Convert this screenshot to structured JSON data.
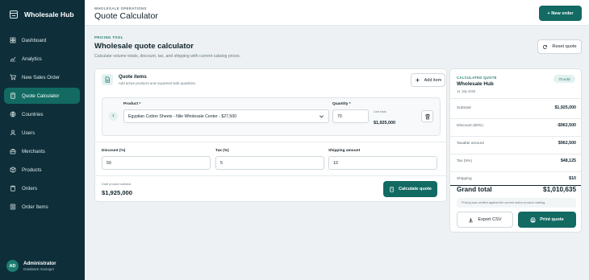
{
  "sidebar": {
    "brand": "Wholesale Hub",
    "items": [
      {
        "label": "Dashboard",
        "icon": "grid-icon"
      },
      {
        "label": "Analytics",
        "icon": "chart-icon"
      },
      {
        "label": "New Sales Order",
        "icon": "cart-icon"
      },
      {
        "label": "Quote Calculator",
        "icon": "calculator-icon",
        "active": true
      },
      {
        "label": "Countries",
        "icon": "globe-icon"
      },
      {
        "label": "Users",
        "icon": "user-icon"
      },
      {
        "label": "Merchants",
        "icon": "briefcase-icon"
      },
      {
        "label": "Products",
        "icon": "box-icon"
      },
      {
        "label": "Orders",
        "icon": "clipboard-icon"
      },
      {
        "label": "Order Items",
        "icon": "list-icon"
      }
    ],
    "user": {
      "initials": "AD",
      "name": "Administrator",
      "role": "Database manager"
    }
  },
  "header": {
    "eyebrow": "WHOLESALE OPERATIONS",
    "title": "Quote Calculator",
    "new_order": "+ New order"
  },
  "tool": {
    "eyebrow": "PRICING TOOL",
    "title": "Wholesale quote calculator",
    "subtitle": "Calculate volume totals, discount, tax, and shipping with current catalog prices.",
    "reset": "Reset quote"
  },
  "items": {
    "title": "Quote items",
    "subtitle": "Add active products and requested bulk quantities.",
    "add_item": "Add item",
    "line": {
      "number": "1",
      "product_label": "Product *",
      "product_value": "Egyptian Cotton Sheets - Nile Wholesale Center - $27,500",
      "quantity_label": "Quantity *",
      "quantity_value": "70",
      "line_total_label": "Line total",
      "line_total_value": "$1,925,000"
    },
    "discount_label": "Discount (%)",
    "discount_value": "50",
    "tax_label": "Tax (%)",
    "tax_value": "5",
    "shipping_label": "Shipping amount",
    "shipping_value": "10",
    "draft_label": "Draft product subtotal",
    "draft_value": "$1,925,000",
    "calculate": "Calculate quote"
  },
  "summary": {
    "eyebrow": "CALCULATED QUOTE",
    "title": "Wholesale Hub",
    "date": "14 July 2026",
    "badge": "70 units",
    "rows": [
      {
        "label": "Subtotal",
        "value": "$1,925,000"
      },
      {
        "label": "Discount (50%)",
        "value": "-$962,500"
      },
      {
        "label": "Taxable amount",
        "value": "$962,500"
      },
      {
        "label": "Tax (5%)",
        "value": "$48,125"
      },
      {
        "label": "Shipping",
        "value": "$10"
      }
    ],
    "grand_label": "Grand total",
    "grand_value": "$1,010,635",
    "note": "Pricing was verified against the current active product catalog.",
    "export": "Export CSV",
    "print": "Print quote"
  },
  "colors": {
    "sidebar": "#0e2f3a",
    "accent": "#126a63",
    "background": "#eef1f3"
  }
}
